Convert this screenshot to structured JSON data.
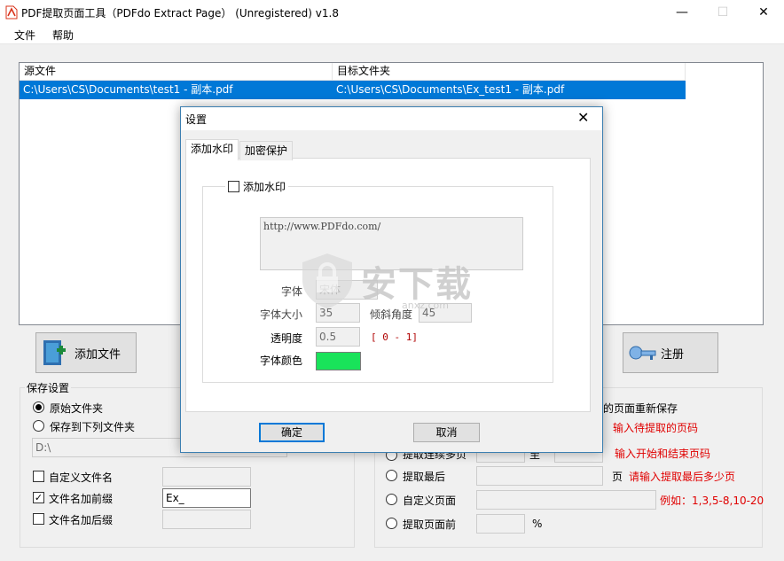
{
  "window": {
    "title": "PDF提取页面工具（PDFdo Extract Page） (Unregistered) v1.8",
    "minimize": "—",
    "maximize": "☐",
    "close": "✕"
  },
  "menu": {
    "file": "文件",
    "help": "帮助"
  },
  "file_list": {
    "columns": [
      "源文件",
      "目标文件夹"
    ],
    "rows": [
      {
        "source": "C:\\Users\\CS\\Documents\\test1 - 副本.pdf",
        "target": "C:\\Users\\CS\\Documents\\Ex_test1 - 副本.pdf"
      }
    ]
  },
  "buttons": {
    "add_file": "添加文件",
    "register": "注册"
  },
  "save_settings": {
    "title": "保存设置",
    "original_folder": "原始文件夹",
    "save_to_folder": "保存到下列文件夹",
    "folder_path": "D:\\",
    "custom_filename": "自定义文件名",
    "filename_prefix": "文件名加前缀",
    "prefix_value": "Ex_",
    "filename_suffix": "文件名加后缀"
  },
  "extract_panel": {
    "resave_suffix": "的页面重新保存",
    "hint_pages": "输入待提取的页码",
    "hint_range": "输入开始和结束页码",
    "range_to": "至",
    "range_label": "提取连续多页",
    "last_label": "提取最后",
    "last_unit": "页",
    "hint_last": "请输入提取最后多少页",
    "custom_label": "自定义页面",
    "hint_custom": "例如：1,3,5-8,10-20",
    "front_label": "提取页面前",
    "percent": "%"
  },
  "dialog": {
    "title": "设置",
    "close": "✕",
    "tabs": [
      "添加水印",
      "加密保护"
    ],
    "add_watermark": "添加水印",
    "watermark_text": "http://www.PDFdo.com/",
    "font_label": "字体",
    "font_value": "宋体",
    "font_size_label": "字体大小",
    "font_size_value": "35",
    "tilt_label": "倾斜角度",
    "tilt_value": "45",
    "opacity_label": "透明度",
    "opacity_value": "0.5",
    "opacity_hint": "[ 0 - 1]",
    "font_color_label": "字体颜色",
    "font_color": "#19e35a",
    "ok": "确定",
    "cancel": "取消"
  },
  "watermark_overlay": {
    "text": "安下载",
    "sub": "anxz.com"
  }
}
